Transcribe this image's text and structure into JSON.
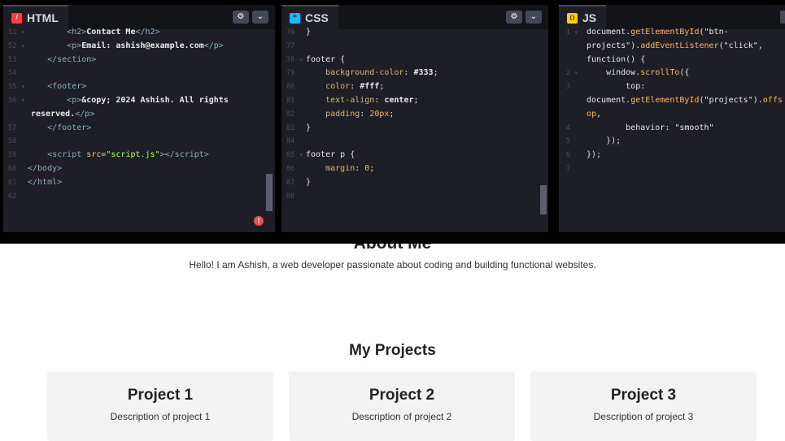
{
  "editors": {
    "html": {
      "tab_label": "HTML",
      "icon_glyph": "/",
      "icon_color": "#ff3c41",
      "line_numbers": [
        "51",
        "52",
        "53",
        "54",
        "55",
        "56",
        "57",
        "58",
        "59",
        "60",
        "61",
        "62"
      ],
      "line_51_text": "Contact Me",
      "line_52_text": "Email: ashish@example.com",
      "line_56_text": "&copy; 2024 Ashish. All rights",
      "line_56_wrap": "reserved.",
      "line_59_src": "\"script.js\"",
      "error_glyph": "!"
    },
    "css": {
      "tab_label": "CSS",
      "icon_glyph": "*",
      "icon_color": "#0ebeff",
      "line_numbers": [
        "76",
        "77",
        "78",
        "79",
        "80",
        "81",
        "82",
        "83",
        "84",
        "85",
        "86",
        "87",
        "88"
      ],
      "selector_footer": "footer",
      "selector_footer_p": "footer p",
      "decls": [
        {
          "prop": "background-color",
          "val": "#333"
        },
        {
          "prop": "color",
          "val": "#fff"
        },
        {
          "prop": "text-align",
          "val": "center"
        },
        {
          "prop": "padding",
          "val": "20px"
        }
      ],
      "margin_prop": "margin",
      "margin_val": "0"
    },
    "js": {
      "tab_label": "JS",
      "icon_glyph": "()",
      "icon_color": "#fcd000",
      "line_numbers": [
        "1",
        "2",
        "3",
        "4",
        "5",
        "6",
        "7"
      ],
      "id_btn_a": "\"btn-",
      "id_btn_b": "projects\"",
      "event_name": "\"click\"",
      "id_projects": "\"projects\"",
      "offs_a": "offs",
      "offs_b": "op",
      "behavior_val": "\"smooth\""
    }
  },
  "preview": {
    "about_heading": "About Me",
    "about_text": "Hello! I am Ashish, a web developer passionate about coding and building functional websites.",
    "projects_heading": "My Projects",
    "projects": [
      {
        "title": "Project 1",
        "description": "Description of project 1"
      },
      {
        "title": "Project 2",
        "description": "Description of project 2"
      },
      {
        "title": "Project 3",
        "description": "Description of project 3"
      }
    ]
  }
}
